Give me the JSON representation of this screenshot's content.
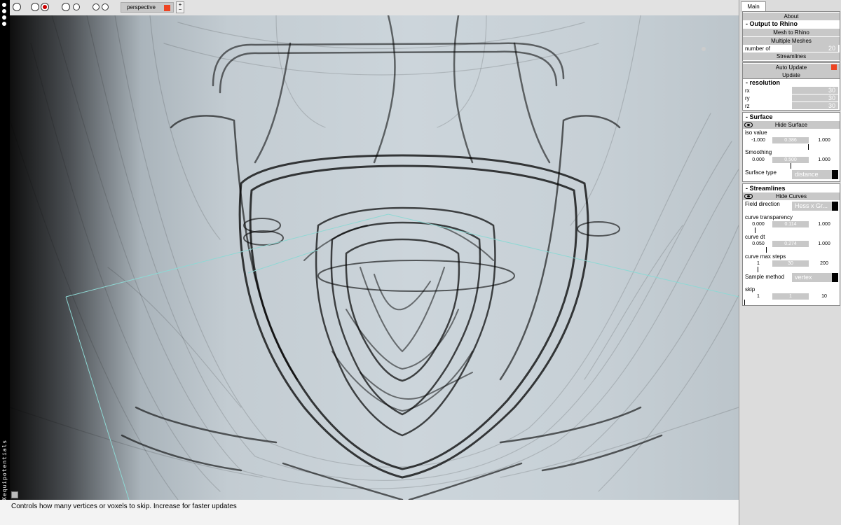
{
  "app": {
    "vertical_label": "Xequipotentials"
  },
  "toolbar": {
    "view_label": "perspective",
    "plus": "+",
    "minus": "−",
    "accent": "#ee4422"
  },
  "status": {
    "text": "Controls how many vertices or voxels to skip. Increase for faster updates"
  },
  "panel": {
    "tab": "Main",
    "about": "About",
    "output": {
      "header": "- Output to Rhino",
      "mesh_btn": "Mesh to Rhino",
      "multi_btn": "Multiple Meshes",
      "number_label": "number of",
      "number_value": "20",
      "stream_btn": "Streamlines"
    },
    "update": {
      "auto_label": "Auto Update",
      "update_btn": "Update"
    },
    "resolution": {
      "header": "- resolution",
      "rx_label": "rx",
      "rx": "30",
      "ry_label": "ry",
      "ry": "30",
      "rz_label": "rz",
      "rz": "30"
    },
    "surface": {
      "header": "- Surface",
      "hide_btn": "Hide Surface",
      "iso_label": "iso value",
      "iso_min": "-1.000",
      "iso_val": "0.386",
      "iso_max": "1.000",
      "iso_level": 0.693,
      "smooth_label": "Smoothing",
      "smooth_min": "0.000",
      "smooth_val": "0.500",
      "smooth_max": "1.000",
      "smooth_level": 0.5,
      "type_label": "Surface type",
      "type_value": "distance"
    },
    "streamlines": {
      "header": "- Streamlines",
      "hide_btn": "Hide Curves",
      "dir_label": "Field direction",
      "dir_value": "Hess x Gr...",
      "transp_label": "curve transparency",
      "transp_min": "0.000",
      "transp_val": "0.114",
      "transp_max": "1.000",
      "transp_level": 0.114,
      "dt_label": "curve dt",
      "dt_min": "0.050",
      "dt_val": "0.274",
      "dt_max": "1.000",
      "dt_level": 0.236,
      "steps_label": "curve max steps",
      "steps_min": "1",
      "steps_val": "30",
      "steps_max": "200",
      "steps_level": 0.146,
      "sample_label": "Sample method",
      "sample_value": "vertex",
      "skip_label": "skip",
      "skip_min": "1",
      "skip_val": "1",
      "skip_max": "10",
      "skip_level": 0.0
    }
  }
}
